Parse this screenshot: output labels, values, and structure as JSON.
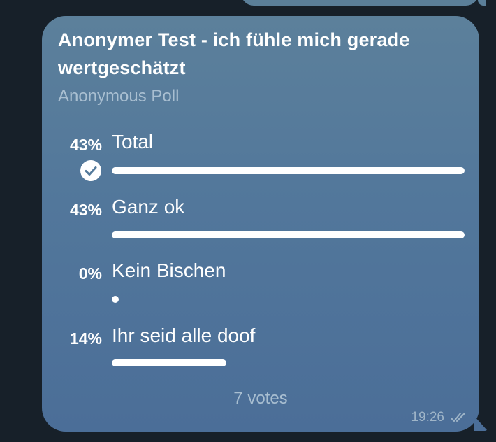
{
  "poll": {
    "question": "Anonymer Test - ich fühle mich gerade wertgeschätzt",
    "type_label": "Anonymous Poll",
    "options": [
      {
        "percent_label": "43%",
        "label": "Total",
        "fraction": 0.43,
        "chosen": true
      },
      {
        "percent_label": "43%",
        "label": "Ganz ok",
        "fraction": 0.43,
        "chosen": false
      },
      {
        "percent_label": "0%",
        "label": "Kein Bischen",
        "fraction": 0.0,
        "chosen": false
      },
      {
        "percent_label": "14%",
        "label": "Ihr seid alle doof",
        "fraction": 0.14,
        "chosen": false
      }
    ],
    "votes_label": "7 votes"
  },
  "message": {
    "time": "19:26",
    "status_icon": "double-check-icon"
  },
  "colors": {
    "background": "#172029",
    "bubble_top": "#5c809b",
    "bubble_bottom": "#4b6e98",
    "muted_text": "#a9bfd1"
  }
}
